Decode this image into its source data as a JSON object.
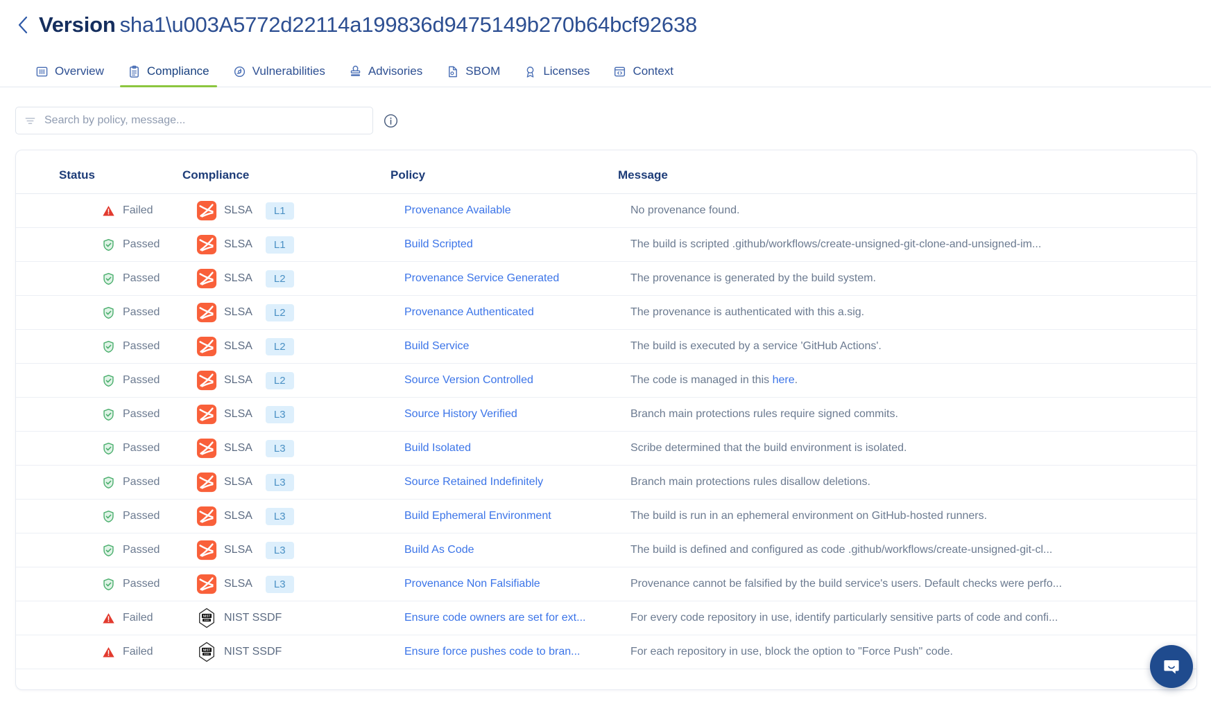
{
  "header": {
    "back_icon": "chevron-left-icon",
    "title_strong": "Version",
    "title_value": "sha1\\u003A5772d22114a199836d9475149b270b64bcf92638"
  },
  "tabs": [
    {
      "label": "Overview",
      "icon": "book-icon",
      "active": false
    },
    {
      "label": "Compliance",
      "icon": "clipboard-icon",
      "active": true
    },
    {
      "label": "Vulnerabilities",
      "icon": "bug-shield-icon",
      "active": false
    },
    {
      "label": "Advisories",
      "icon": "stamp-icon",
      "active": false
    },
    {
      "label": "SBOM",
      "icon": "document-icon",
      "active": false
    },
    {
      "label": "Licenses",
      "icon": "ribbon-icon",
      "active": false
    },
    {
      "label": "Context",
      "icon": "code-window-icon",
      "active": false
    }
  ],
  "search": {
    "placeholder": "Search by policy, message...",
    "value": "",
    "filter_icon": "filter-icon",
    "info_icon": "info-circle-icon"
  },
  "table": {
    "columns": [
      "Status",
      "Compliance",
      "Policy",
      "Message"
    ],
    "rows": [
      {
        "status": "Failed",
        "status_icon": "warning-triangle-icon",
        "framework": "SLSA",
        "framework_icon": "slsa-logo-icon",
        "level": "L1",
        "policy": "Provenance Available",
        "message": "No provenance found."
      },
      {
        "status": "Passed",
        "status_icon": "shield-check-icon",
        "framework": "SLSA",
        "framework_icon": "slsa-logo-icon",
        "level": "L1",
        "policy": "Build Scripted",
        "message": "The build is scripted .github/workflows/create-unsigned-git-clone-and-unsigned-im..."
      },
      {
        "status": "Passed",
        "status_icon": "shield-check-icon",
        "framework": "SLSA",
        "framework_icon": "slsa-logo-icon",
        "level": "L2",
        "policy": "Provenance Service Generated",
        "message": "The provenance is generated by the build system."
      },
      {
        "status": "Passed",
        "status_icon": "shield-check-icon",
        "framework": "SLSA",
        "framework_icon": "slsa-logo-icon",
        "level": "L2",
        "policy": "Provenance Authenticated",
        "message": "The provenance is authenticated with this a.sig."
      },
      {
        "status": "Passed",
        "status_icon": "shield-check-icon",
        "framework": "SLSA",
        "framework_icon": "slsa-logo-icon",
        "level": "L2",
        "policy": "Build Service",
        "message": "The build is executed by a service 'GitHub Actions'."
      },
      {
        "status": "Passed",
        "status_icon": "shield-check-icon",
        "framework": "SLSA",
        "framework_icon": "slsa-logo-icon",
        "level": "L2",
        "policy": "Source Version Controlled",
        "message": "The code is managed in this ",
        "message_link": "here",
        "message_tail": "."
      },
      {
        "status": "Passed",
        "status_icon": "shield-check-icon",
        "framework": "SLSA",
        "framework_icon": "slsa-logo-icon",
        "level": "L3",
        "policy": "Source History Verified",
        "message": "Branch main protections rules require signed commits."
      },
      {
        "status": "Passed",
        "status_icon": "shield-check-icon",
        "framework": "SLSA",
        "framework_icon": "slsa-logo-icon",
        "level": "L3",
        "policy": "Build Isolated",
        "message": "Scribe determined that the build environment is isolated."
      },
      {
        "status": "Passed",
        "status_icon": "shield-check-icon",
        "framework": "SLSA",
        "framework_icon": "slsa-logo-icon",
        "level": "L3",
        "policy": "Source Retained Indefinitely",
        "message": "Branch main protections rules disallow deletions."
      },
      {
        "status": "Passed",
        "status_icon": "shield-check-icon",
        "framework": "SLSA",
        "framework_icon": "slsa-logo-icon",
        "level": "L3",
        "policy": "Build Ephemeral Environment",
        "message": "The build is run in an ephemeral environment on GitHub-hosted runners."
      },
      {
        "status": "Passed",
        "status_icon": "shield-check-icon",
        "framework": "SLSA",
        "framework_icon": "slsa-logo-icon",
        "level": "L3",
        "policy": "Build As Code",
        "message": "The build is defined and configured as code .github/workflows/create-unsigned-git-cl..."
      },
      {
        "status": "Passed",
        "status_icon": "shield-check-icon",
        "framework": "SLSA",
        "framework_icon": "slsa-logo-icon",
        "level": "L3",
        "policy": "Provenance Non Falsifiable",
        "message": "Provenance cannot be falsified by the build service's users. Default checks were perfo..."
      },
      {
        "status": "Failed",
        "status_icon": "warning-triangle-icon",
        "framework": "NIST SSDF",
        "framework_icon": "nist-ssdf-logo-icon",
        "level": "",
        "policy": "Ensure code owners are set for ext...",
        "message": "For every code repository in use, identify particularly sensitive parts of code and confi..."
      },
      {
        "status": "Failed",
        "status_icon": "warning-triangle-icon",
        "framework": "NIST SSDF",
        "framework_icon": "nist-ssdf-logo-icon",
        "level": "",
        "policy": "Ensure force pushes code to bran...",
        "message": "For each repository in use, block the option to \"Force Push\" code."
      }
    ]
  },
  "chat": {
    "icon": "chat-bubble-icon"
  },
  "colors": {
    "accent_tab": "#8cc63f",
    "link": "#3b74e8",
    "failed": "#e23a2e",
    "passed": "#4caf6e",
    "title": "#1d3c78",
    "badge_bg": "#ddeffc",
    "badge_fg": "#4a90c4",
    "chat_bg": "#1f4b8e"
  }
}
